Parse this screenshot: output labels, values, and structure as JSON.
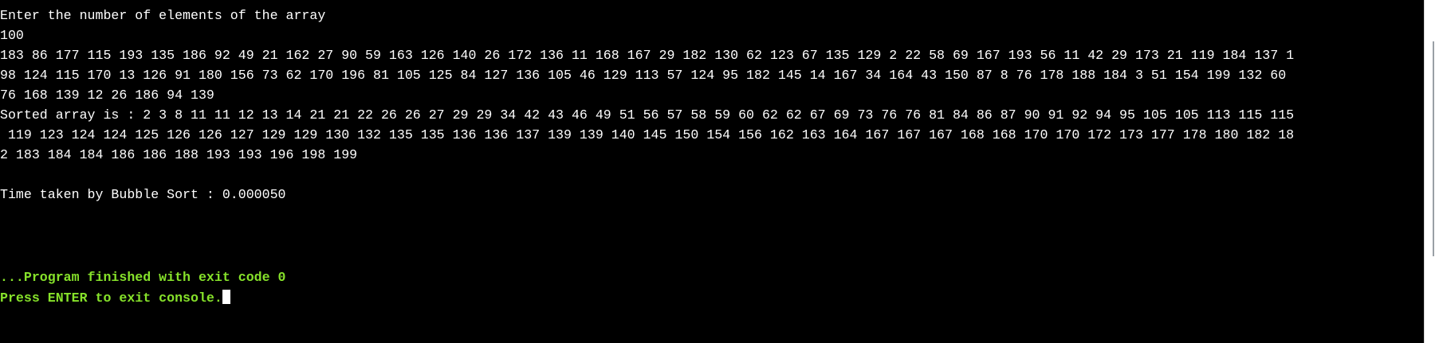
{
  "console": {
    "lines": [
      "Enter the number of elements of the array",
      "100",
      "183 86 177 115 193 135 186 92 49 21 162 27 90 59 163 126 140 26 172 136 11 168 167 29 182 130 62 123 67 135 129 2 22 58 69 167 193 56 11 42 29 173 21 119 184 137 1",
      "98 124 115 170 13 126 91 180 156 73 62 170 196 81 105 125 84 127 136 105 46 129 113 57 124 95 182 145 14 167 34 164 43 150 87 8 76 178 188 184 3 51 154 199 132 60",
      "76 168 139 12 26 186 94 139",
      "Sorted array is : 2 3 8 11 11 12 13 14 21 21 22 26 26 27 29 29 34 42 43 46 49 51 56 57 58 59 60 62 62 67 69 73 76 76 81 84 86 87 90 91 92 94 95 105 105 113 115 115",
      " 119 123 124 124 125 126 126 127 129 129 130 132 135 135 136 136 137 139 139 140 145 150 154 156 162 163 164 167 167 167 168 168 170 170 172 173 177 178 180 182 18",
      "2 183 184 184 186 186 188 193 193 196 198 199",
      "",
      "Time taken by Bubble Sort : 0.000050"
    ],
    "finish_message": "...Program finished with exit code 0",
    "exit_prompt": "Press ENTER to exit console."
  },
  "colors": {
    "background": "#000000",
    "text": "#ffffff",
    "status_green": "#86e22a"
  }
}
